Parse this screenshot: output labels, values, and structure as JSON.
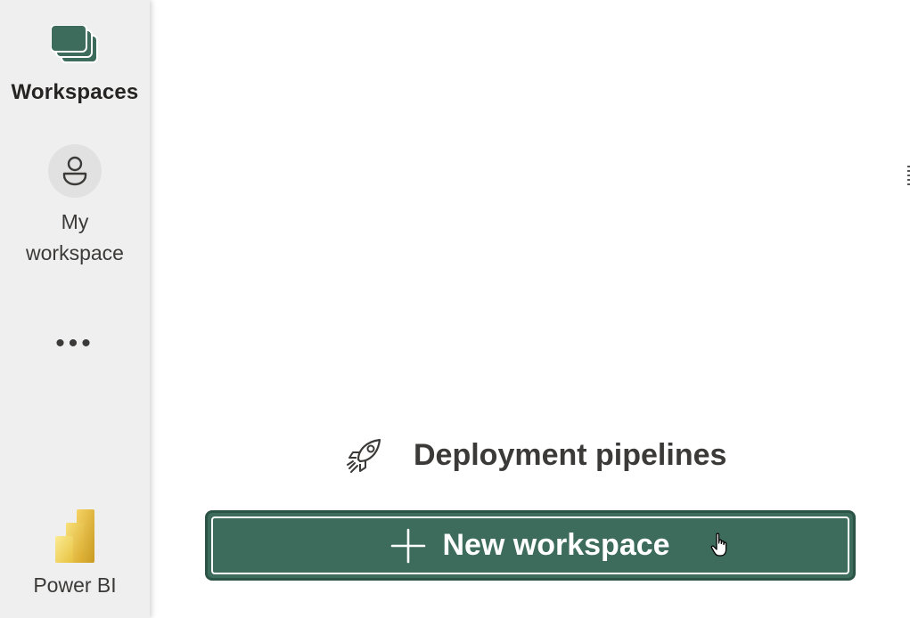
{
  "rail": {
    "workspaces_label": "Workspaces",
    "my_workspace_label_line1": "My",
    "my_workspace_label_line2": "workspace",
    "more_label": "•••",
    "app_label": "Power BI",
    "icons": {
      "workspaces": "workspaces-stack-icon",
      "my_workspace": "person-icon",
      "more": "more-icon",
      "app": "power-bi-logo"
    }
  },
  "main": {
    "pipelines_label": "Deployment pipelines",
    "pipelines_icon": "rocket-icon",
    "new_workspace_label": "New workspace",
    "new_workspace_icon": "plus-icon"
  },
  "colors": {
    "accent": "#3d6b5c",
    "rail_bg": "#efefef",
    "text": "#3b3a39",
    "powerbi_yellow": "#f2c811"
  }
}
